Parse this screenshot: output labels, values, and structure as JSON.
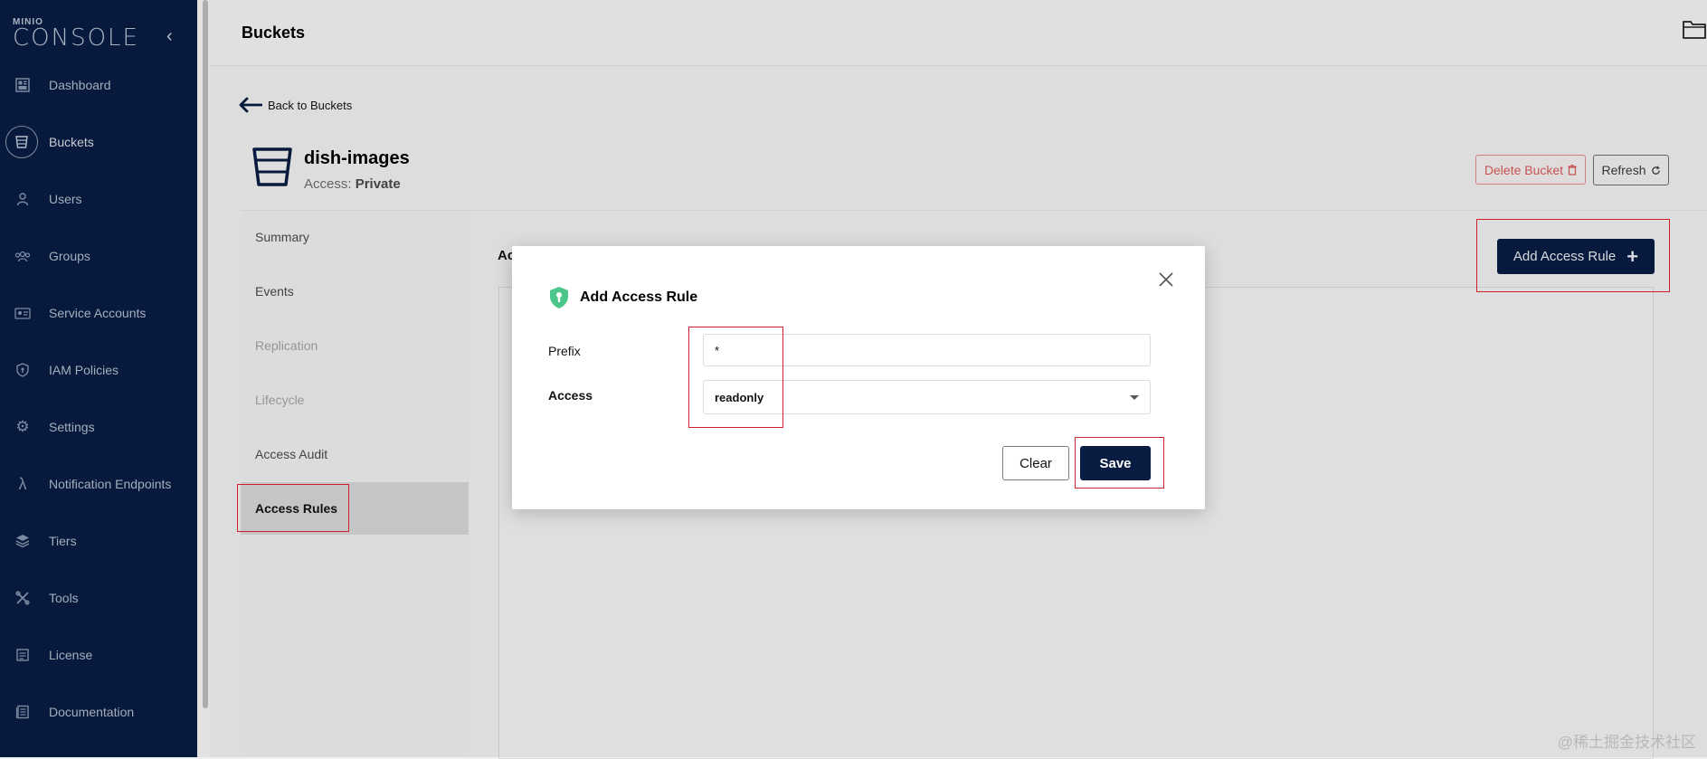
{
  "app": {
    "logo_brand": "MINIO",
    "logo_product": "CONSOLE"
  },
  "sidebar": {
    "items": [
      {
        "label": "Dashboard",
        "icon": "dashboard-icon"
      },
      {
        "label": "Buckets",
        "icon": "bucket-icon",
        "active": true
      },
      {
        "label": "Users",
        "icon": "user-icon"
      },
      {
        "label": "Groups",
        "icon": "groups-icon"
      },
      {
        "label": "Service Accounts",
        "icon": "service-accounts-icon"
      },
      {
        "label": "IAM Policies",
        "icon": "shield-icon"
      },
      {
        "label": "Settings",
        "icon": "gear-icon"
      },
      {
        "label": "Notification Endpoints",
        "icon": "lambda-icon"
      },
      {
        "label": "Tiers",
        "icon": "tiers-icon"
      },
      {
        "label": "Tools",
        "icon": "tools-icon"
      },
      {
        "label": "License",
        "icon": "license-icon"
      },
      {
        "label": "Documentation",
        "icon": "documentation-icon"
      }
    ]
  },
  "header": {
    "title": "Buckets"
  },
  "content": {
    "back_link": "Back to Buckets",
    "bucket_name": "dish-images",
    "access_prefix": "Access: ",
    "access_value": "Private",
    "delete_bucket_label": "Delete Bucket",
    "refresh_label": "Refresh",
    "tabs": [
      {
        "label": "Summary"
      },
      {
        "label": "Events"
      },
      {
        "label": "Replication",
        "disabled": true
      },
      {
        "label": "Lifecycle",
        "disabled": true
      },
      {
        "label": "Access Audit"
      },
      {
        "label": "Access Rules",
        "active": true
      }
    ],
    "rules_title_visible": "Ac",
    "add_access_rule_label": "Add Access Rule"
  },
  "modal": {
    "title": "Add Access Rule",
    "prefix_label": "Prefix",
    "prefix_value": "*",
    "access_label": "Access",
    "access_value": "readonly",
    "clear_label": "Clear",
    "save_label": "Save"
  },
  "watermark": "@稀土掘金技术社区",
  "colors": {
    "sidebar_bg": "#081c42",
    "primary_button": "#081c42",
    "danger": "#d65a5a",
    "annotation": "#d0202a",
    "accent_icon": "#4cc68a"
  }
}
